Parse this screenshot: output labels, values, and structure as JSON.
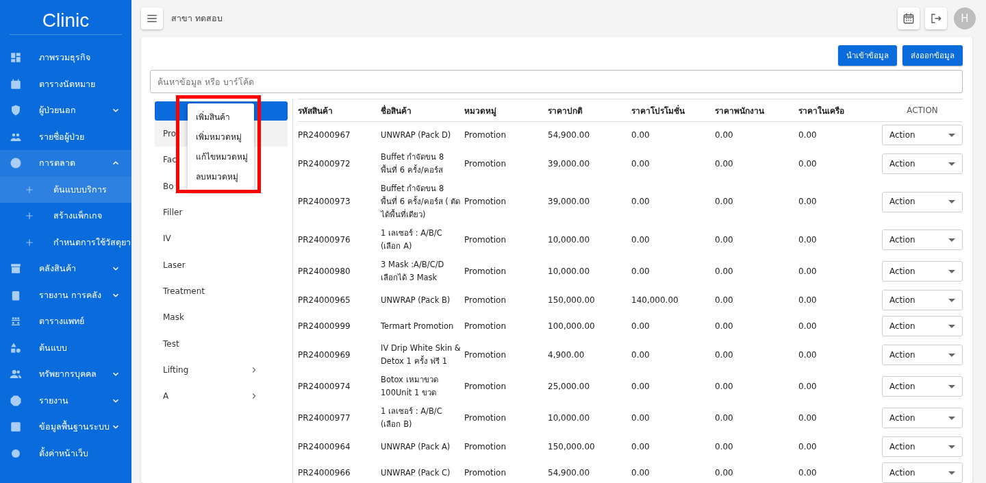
{
  "sidebar": {
    "logo": "Clinic",
    "items": [
      {
        "label": "ภาพรวมธุรกิจ"
      },
      {
        "label": "ตารางนัดหมาย"
      },
      {
        "label": "ผู้ป่วยนอก",
        "expanded": false
      },
      {
        "label": "รายชื่อผู้ป่วย"
      },
      {
        "label": "การตลาด",
        "expanded": true,
        "children": [
          {
            "label": "ต้นแบบบริการ",
            "selected": true
          },
          {
            "label": "สร้างแพ็กเกจ",
            "selected": false
          },
          {
            "label": "กำหนดการใช้วัสดุยา",
            "selected": false
          }
        ]
      },
      {
        "label": "คลังสินค้า",
        "expanded": false
      },
      {
        "label": "รายงาน การคลัง",
        "expanded": false
      },
      {
        "label": "ตารางแพทย์"
      },
      {
        "label": "ต้นแบบ"
      },
      {
        "label": "ทรัพยากรบุคคล",
        "expanded": false
      },
      {
        "label": "รายงาน",
        "expanded": false
      },
      {
        "label": "ข้อมูลพื้นฐานระบบ",
        "expanded": false
      },
      {
        "label": "ตั้งค่าหน้าเว็บ"
      }
    ]
  },
  "topbar": {
    "branch": "สาขา ทดสอบ",
    "avatar": "H"
  },
  "buttons": [
    "นำเข้าข้อมูล",
    "ส่งออกข้อมูล"
  ],
  "search": {
    "placeholder": "ค้นหาข้อมูล หรือ บาร์โค้ด"
  },
  "categories": [
    {
      "label": "Pro",
      "selected": true,
      "expandable": false
    },
    {
      "label": "Fac",
      "selected": false,
      "expandable": false
    },
    {
      "label": "Bo",
      "selected": false,
      "expandable": false
    },
    {
      "label": "Filler",
      "selected": false,
      "expandable": false
    },
    {
      "label": "IV",
      "selected": false,
      "expandable": false
    },
    {
      "label": "Laser",
      "selected": false,
      "expandable": false
    },
    {
      "label": "Treatment",
      "selected": false,
      "expandable": false
    },
    {
      "label": "Mask",
      "selected": false,
      "expandable": false
    },
    {
      "label": "Test",
      "selected": false,
      "expandable": false
    },
    {
      "label": "Lifting",
      "selected": false,
      "expandable": true
    },
    {
      "label": "A",
      "selected": false,
      "expandable": true
    }
  ],
  "menu": {
    "highlighted": true,
    "items": [
      "เพิ่มสินค้า",
      "เพิ่มหมวดหมู่",
      "แก้ไขหมวดหมู่",
      "ลบหมวดหมู่"
    ]
  },
  "table": {
    "columns": [
      "รหัสสินค้า",
      "ชื่อสินค้า",
      "หมวดหมู่",
      "ราคาปกติ",
      "ราคาโปรโมชั่น",
      "ราคาพนักงาน",
      "ราคาในเครือ",
      "ACTION"
    ],
    "rows": [
      [
        "PR24000967",
        "UNWRAP (Pack D)",
        "Promotion",
        "54,900.00",
        "0.00",
        "0.00",
        "0.00",
        "Action"
      ],
      [
        "PR24000972",
        "Buffet กำจัดขน 8 พื้นที่ 6 ครั้ง/คอร์ส",
        "Promotion",
        "39,000.00",
        "0.00",
        "0.00",
        "0.00",
        "Action"
      ],
      [
        "PR24000973",
        "Buffet กำจัดขน 8 พื้นที่ 6 ครั้ง/คอร์ส ( ตัดได้พื้นที่เดียว)",
        "Promotion",
        "39,000.00",
        "0.00",
        "0.00",
        "0.00",
        "Action"
      ],
      [
        "PR24000976",
        "1 เลเซอร์ : A/B/C (เลือก A)",
        "Promotion",
        "10,000.00",
        "0.00",
        "0.00",
        "0.00",
        "Action"
      ],
      [
        "PR24000980",
        "3 Mask :A/B/C/D เลือกได้ 3 Mask",
        "Promotion",
        "10,000.00",
        "0.00",
        "0.00",
        "0.00",
        "Action"
      ],
      [
        "PR24000965",
        "UNWRAP (Pack B)",
        "Promotion",
        "150,000.00",
        "140,000.00",
        "0.00",
        "0.00",
        "Action"
      ],
      [
        "PR24000999",
        "Termart Promotion",
        "Promotion",
        "100,000.00",
        "0.00",
        "0.00",
        "0.00",
        "Action"
      ],
      [
        "PR24000969",
        "IV Drip White Skin & Detox 1 ครั้ง ฟรี 1",
        "Promotion",
        "4,900.00",
        "0.00",
        "0.00",
        "0.00",
        "Action"
      ],
      [
        "PR24000974",
        "Botox เหมาขวด 100Unit 1 ขวด",
        "Promotion",
        "25,000.00",
        "0.00",
        "0.00",
        "0.00",
        "Action"
      ],
      [
        "PR24000977",
        "1 เลเซอร์ : A/B/C (เลือก B)",
        "Promotion",
        "10,000.00",
        "0.00",
        "0.00",
        "0.00",
        "Action"
      ],
      [
        "PR24000964",
        "UNWRAP (Pack A)",
        "Promotion",
        "150,000.00",
        "0.00",
        "0.00",
        "0.00",
        "Action"
      ],
      [
        "PR24000966",
        "UNWRAP (Pack C)",
        "Promotion",
        "54,900.00",
        "0.00",
        "0.00",
        "0.00",
        "Action"
      ]
    ]
  }
}
